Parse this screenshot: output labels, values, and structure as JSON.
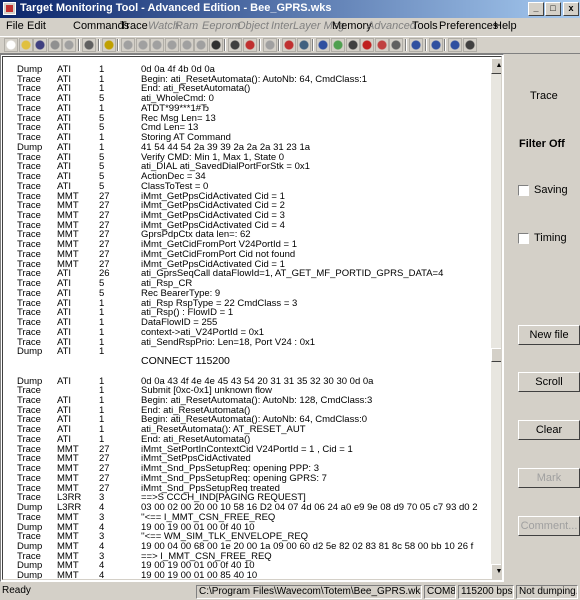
{
  "window": {
    "title": "Target Monitoring Tool - Advanced Edition - Bee_GPRS.wks",
    "min_glyph": "_",
    "max_glyph": "□",
    "close_glyph": "x"
  },
  "menu": [
    {
      "label": "File",
      "enabled": true
    },
    {
      "label": "Edit",
      "enabled": true
    },
    {
      "label": "Commands",
      "enabled": true
    },
    {
      "label": "Trace",
      "enabled": true
    },
    {
      "label": "Watch",
      "enabled": false
    },
    {
      "label": "Ram",
      "enabled": false
    },
    {
      "label": "Eeprom",
      "enabled": false
    },
    {
      "label": "Object",
      "enabled": false
    },
    {
      "label": "InterLayer Msg",
      "enabled": false
    },
    {
      "label": "Memory",
      "enabled": true
    },
    {
      "label": "Advanced",
      "enabled": false
    },
    {
      "label": "Tools",
      "enabled": true
    },
    {
      "label": "Preferences",
      "enabled": true
    },
    {
      "label": "Help",
      "enabled": true
    }
  ],
  "toolbar": [
    {
      "name": "new-icon",
      "color": "#ffffff"
    },
    {
      "name": "open-icon",
      "color": "#e0c040"
    },
    {
      "name": "save-icon",
      "color": "#404080"
    },
    {
      "name": "print-icon",
      "color": "#909090"
    },
    {
      "name": "properties-icon",
      "color": "#a0a0a0"
    },
    {
      "name": "sep"
    },
    {
      "name": "connect-icon",
      "color": "#606060"
    },
    {
      "name": "sep"
    },
    {
      "name": "info-icon",
      "color": "#c0a000"
    },
    {
      "name": "sep"
    },
    {
      "name": "watch-icon",
      "color": "#a0a0a0"
    },
    {
      "name": "ram-icon",
      "color": "#a0a0a0"
    },
    {
      "name": "eeprom-icon",
      "color": "#a0a0a0"
    },
    {
      "name": "object-icon",
      "color": "#a0a0a0"
    },
    {
      "name": "layer-icon",
      "color": "#a0a0a0"
    },
    {
      "name": "layer2-icon",
      "color": "#a0a0a0"
    },
    {
      "name": "memory-icon",
      "color": "#303030"
    },
    {
      "name": "sep"
    },
    {
      "name": "trace-icon",
      "color": "#404040"
    },
    {
      "name": "trace-stop-icon",
      "color": "#c03030"
    },
    {
      "name": "sep"
    },
    {
      "name": "filter-icon",
      "color": "#a0a0a0"
    },
    {
      "name": "sep"
    },
    {
      "name": "at-icon",
      "color": "#c03030"
    },
    {
      "name": "sim-icon",
      "color": "#406080"
    },
    {
      "name": "sep"
    },
    {
      "name": "globe-icon",
      "color": "#3050a0"
    },
    {
      "name": "chart-icon",
      "color": "#50a050"
    },
    {
      "name": "options-icon",
      "color": "#404040"
    },
    {
      "name": "stop-icon",
      "color": "#c02020"
    },
    {
      "name": "record-icon",
      "color": "#c04040"
    },
    {
      "name": "tools-icon",
      "color": "#606060"
    },
    {
      "name": "sep"
    },
    {
      "name": "cycle-icon",
      "color": "#3050a0"
    },
    {
      "name": "sep"
    },
    {
      "name": "d-icon",
      "color": "#3050a0"
    },
    {
      "name": "sep"
    },
    {
      "name": "wave-icon",
      "color": "#3050a0"
    },
    {
      "name": "refresh-icon",
      "color": "#404040"
    }
  ],
  "log": [
    [
      "Dump",
      "ATI",
      "1",
      "0d 0a 4f 4b 0d 0a"
    ],
    [
      "Trace",
      "ATI",
      "1",
      "Begin: ati_ResetAutomata(): AutoNb: 64, CmdClass:1"
    ],
    [
      "Trace",
      "ATI",
      "1",
      "End: ati_ResetAutomata()"
    ],
    [
      "Trace",
      "ATI",
      "5",
      "ati_WholeCmd: 0"
    ],
    [
      "Trace",
      "ATI",
      "1",
      "ATDT*99***1#Ђ"
    ],
    [
      "Trace",
      "ATI",
      "5",
      "Rec Msg Len= 13"
    ],
    [
      "Trace",
      "ATI",
      "5",
      "Cmd Len= 13"
    ],
    [
      "Trace",
      "ATI",
      "1",
      "Storing AT Command"
    ],
    [
      "Dump",
      "ATI",
      "1",
      "41 54 44 54 2a 39 39 2a 2a 2a 31 23 1a"
    ],
    [
      "Trace",
      "ATI",
      "5",
      "Verify CMD: Min 1, Max 1, State 0"
    ],
    [
      "Trace",
      "ATI",
      "5",
      "ati_DIAL ati_SavedDialPortForStk = 0x1"
    ],
    [
      "Trace",
      "ATI",
      "5",
      "ActionDec = 34"
    ],
    [
      "Trace",
      "ATI",
      "5",
      "ClassToTest = 0"
    ],
    [
      "Trace",
      "MMT",
      "27",
      "iMmt_GetPpsCidActivated Cid = 1"
    ],
    [
      "Trace",
      "MMT",
      "27",
      "iMmt_GetPpsCidActivated Cid = 2"
    ],
    [
      "Trace",
      "MMT",
      "27",
      "iMmt_GetPpsCidActivated Cid = 3"
    ],
    [
      "Trace",
      "MMT",
      "27",
      "iMmt_GetPpsCidActivated Cid = 4"
    ],
    [
      "Trace",
      "MMT",
      "27",
      "GprsPdpCtx data len=: 62"
    ],
    [
      "Trace",
      "MMT",
      "27",
      "iMmt_GetCidFromPort V24PortId = 1"
    ],
    [
      "Trace",
      "MMT",
      "27",
      "iMmt_GetCidFromPort Cid not found"
    ],
    [
      "Trace",
      "MMT",
      "27",
      "iMmt_GetPpsCidActivated Cid = 1"
    ],
    [
      "Trace",
      "ATI",
      "26",
      "ati_GprsSeqCall dataFlowId=1, AT_GET_MF_PORTID_GPRS_DATA=4"
    ],
    [
      "Trace",
      "ATI",
      "5",
      "ati_Rsp_CR"
    ],
    [
      "Trace",
      "ATI",
      "5",
      "Rec BearerType: 9"
    ],
    [
      "Trace",
      "ATI",
      "1",
      "ati_Rsp RspType = 22 CmdClass = 3"
    ],
    [
      "Trace",
      "ATI",
      "1",
      "ati_Rsp() : FlowID = 1"
    ],
    [
      "Trace",
      "ATI",
      "1",
      "DataFlowID = 255"
    ],
    [
      "Trace",
      "ATI",
      "1",
      "context->ati_V24PortId = 0x1"
    ],
    [
      "Trace",
      "ATI",
      "1",
      "ati_SendRspPrio: Len=18, Port V24 : 0x1"
    ],
    [
      "Dump",
      "ATI",
      "1",
      ""
    ],
    [
      "",
      "",
      "",
      "CONNECT 115200"
    ],
    [
      "",
      "",
      "",
      ""
    ],
    [
      "Dump",
      "ATI",
      "1",
      "0d 0a 43 4f 4e 4e 45 43 54 20 31 31 35 32 30 30 0d 0a"
    ],
    [
      "Trace",
      "",
      "1",
      "Submit [0xc-0x1] unknown flow"
    ],
    [
      "Trace",
      "ATI",
      "1",
      "Begin: ati_ResetAutomata(): AutoNb: 128, CmdClass:3"
    ],
    [
      "Trace",
      "ATI",
      "1",
      "End: ati_ResetAutomata()"
    ],
    [
      "Trace",
      "ATI",
      "1",
      "Begin: ati_ResetAutomata(): AutoNb: 64, CmdClass:0"
    ],
    [
      "Trace",
      "ATI",
      "1",
      "ati_ResetAutomata(): AT_RESET_AUT"
    ],
    [
      "Trace",
      "ATI",
      "1",
      "End: ati_ResetAutomata()"
    ],
    [
      "Trace",
      "MMT",
      "27",
      "iMmt_SetPortInContextCid V24PortId = 1 , Cid = 1"
    ],
    [
      "Trace",
      "MMT",
      "27",
      "iMmt_SetPpsCidActivated"
    ],
    [
      "Trace",
      "MMT",
      "27",
      "iMmt_Snd_PpsSetupReq: opening PPP: 3"
    ],
    [
      "Trace",
      "MMT",
      "27",
      "iMmt_Snd_PpsSetupReq: opening GPRS: 7"
    ],
    [
      "Trace",
      "MMT",
      "27",
      "iMmt_Snd_PpsSetupReq treated"
    ],
    [
      "Trace",
      "L3RR",
      "3",
      "==>S CCCH_IND[PAGING REQUEST]"
    ],
    [
      "Dump",
      "L3RR",
      "4",
      "03 00 02 00 20 00 10 58 16 D2 04 07 4d 06 24 a0 e9 9e 08 d9 70 05 c7 93 d0 2"
    ],
    [
      "Trace",
      "MMT",
      "3",
      "''<== I_MMT_CSN_FREE_REQ"
    ],
    [
      "Dump",
      "MMT",
      "4",
      "19 00 19 00 01 00 0f 40 10"
    ],
    [
      "Trace",
      "MMT",
      "3",
      "''<== WM_SIM_TLK_ENVELOPE_REQ"
    ],
    [
      "Dump",
      "MMT",
      "4",
      "19 00 04 00 68 00 1e 20 00 1a 09 00 60 d2 5e 82 02 83 81 8c 58 00 bb 10 26 f"
    ],
    [
      "Trace",
      "MMT",
      "3",
      "==> I_MMT_CSN_FREE_REQ"
    ],
    [
      "Dump",
      "MMT",
      "4",
      "19 00 19 00 01 00 0f 40 10"
    ],
    [
      "Dump",
      "MMT",
      "4",
      "19 00 19 00 01 00 85 40 10"
    ],
    [
      "Dump",
      "MMT",
      "4",
      "19 00 19 00 01 00 85 40 10"
    ]
  ],
  "right_panel": {
    "trace_label": "Trace",
    "filter_label": "Filter Off",
    "saving_label": "Saving",
    "timing_label": "Timing",
    "new_file_label": "New file",
    "scroll_label": "Scroll",
    "clear_label": "Clear",
    "mark_label": "Mark",
    "comment_label": "Comment..."
  },
  "status": {
    "ready": "Ready",
    "path": "C:\\Program Files\\Wavecom\\Totem\\Bee_GPRS.wks",
    "port": "COM8",
    "baud": "115200 bps",
    "dumping": "Not dumping..."
  }
}
